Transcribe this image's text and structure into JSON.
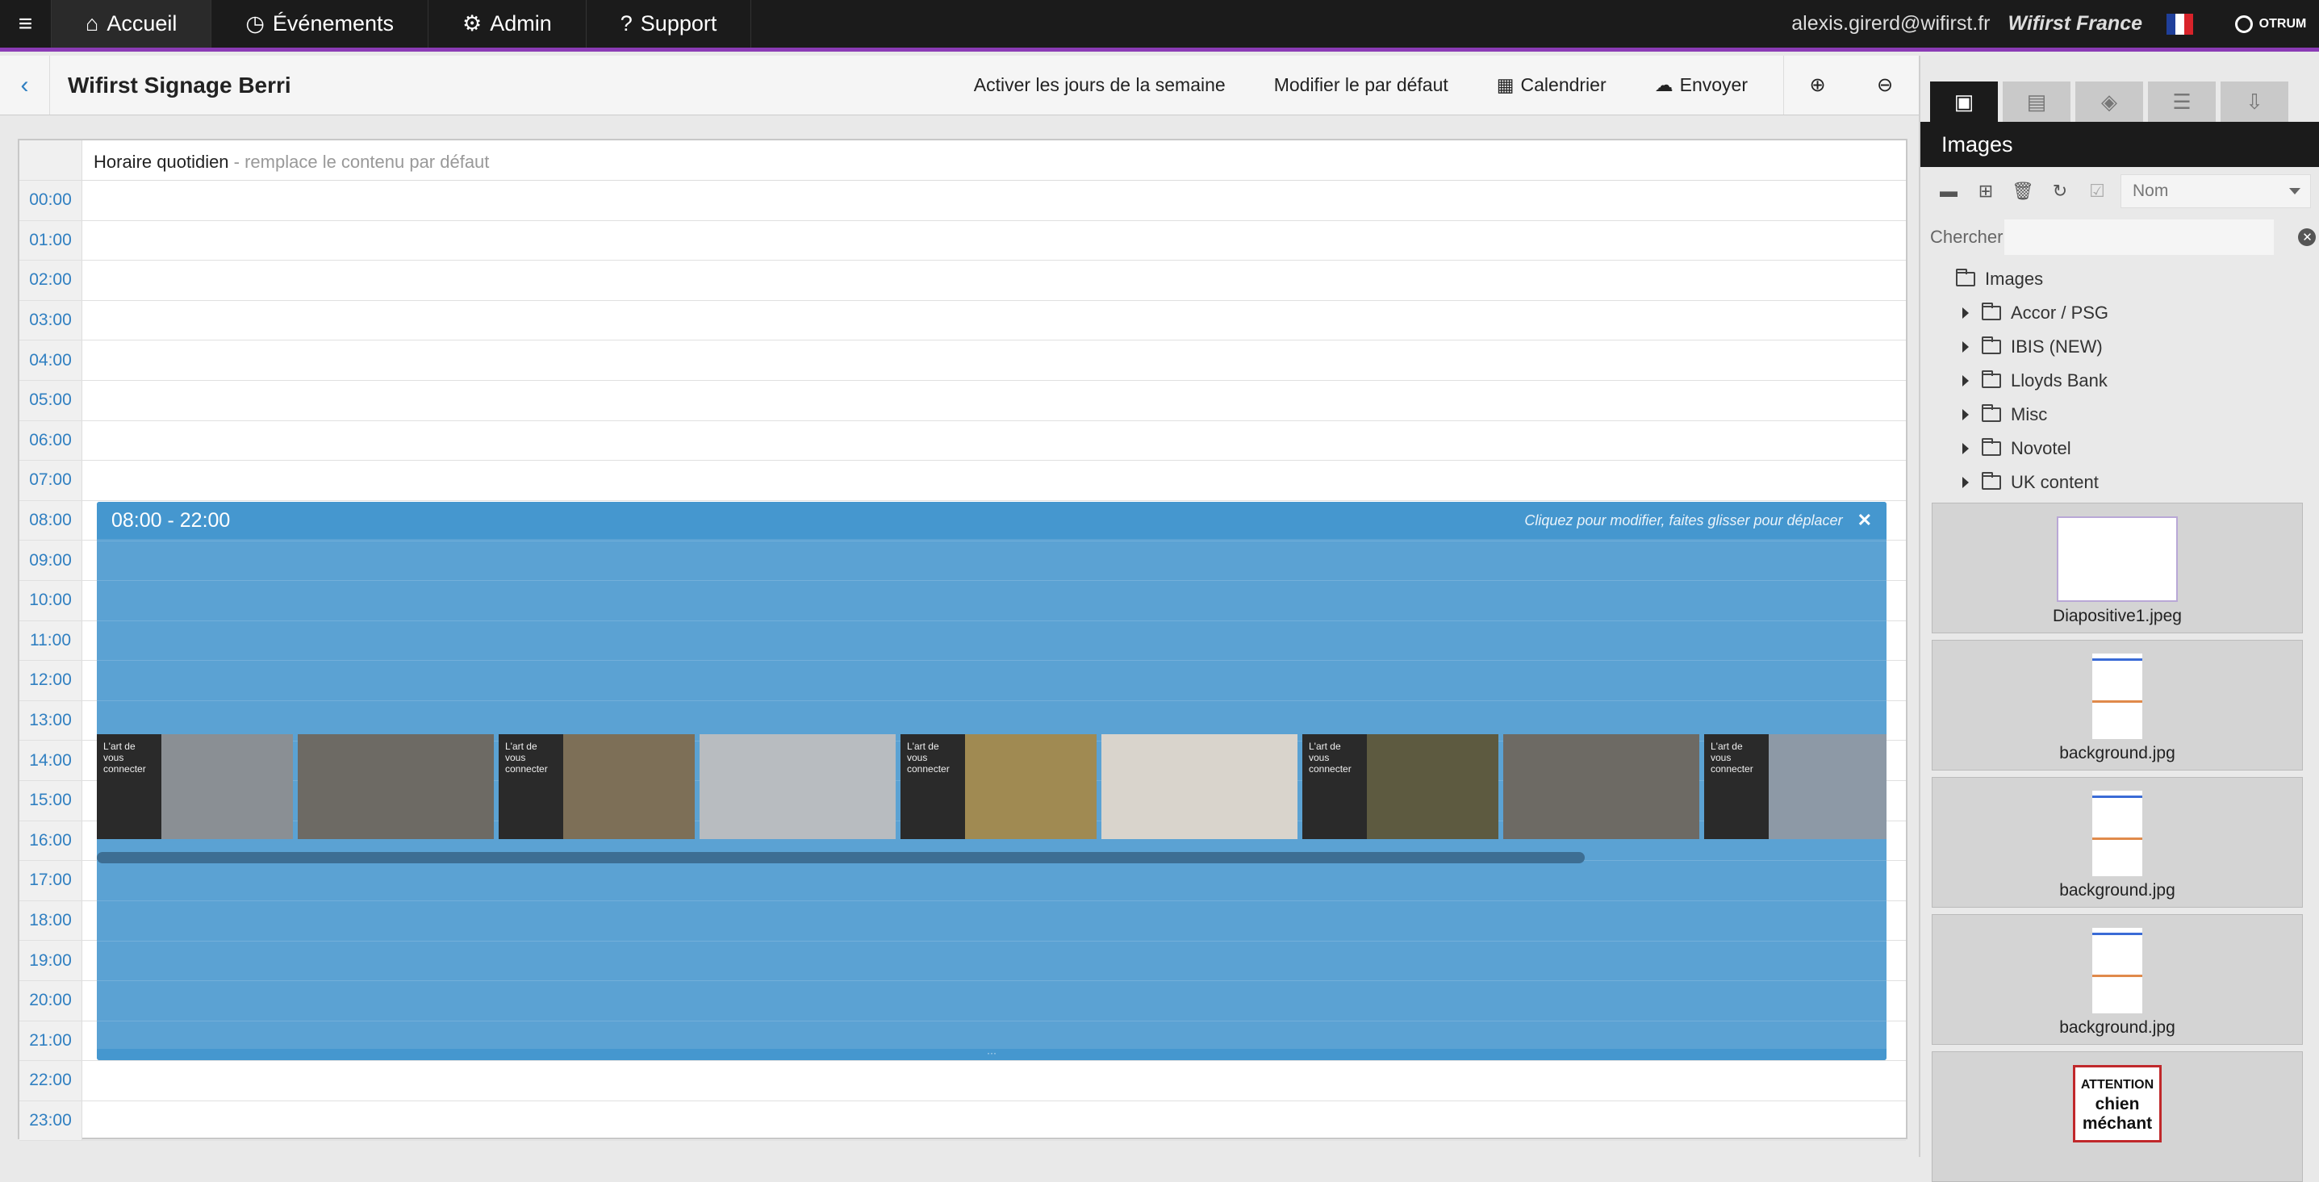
{
  "nav": {
    "items": [
      {
        "icon": "home-icon",
        "glyph": "⌂",
        "label": "Accueil"
      },
      {
        "icon": "clock-icon",
        "glyph": "◷",
        "label": "Événements"
      },
      {
        "icon": "gears-icon",
        "glyph": "⚙",
        "label": "Admin"
      },
      {
        "icon": "question-icon",
        "glyph": "?",
        "label": "Support"
      }
    ],
    "user": "alexis.girerd@wifirst.fr",
    "org": "Wifirst France",
    "brand": "OTRUM",
    "colors": {
      "accent": "#8a3bb5",
      "bar": "#1b1b1b"
    }
  },
  "toolbar": {
    "title": "Wifirst Signage Berri",
    "weekdays": "Activer les jours de la semaine",
    "default": "Modifier le par défaut",
    "calendar": "Calendrier",
    "send": "Envoyer"
  },
  "schedule": {
    "header_title": "Horaire quotidien",
    "header_sub": " - remplace le contenu par défaut",
    "hours": [
      "00:00",
      "01:00",
      "02:00",
      "03:00",
      "04:00",
      "05:00",
      "06:00",
      "07:00",
      "08:00",
      "09:00",
      "10:00",
      "11:00",
      "12:00",
      "13:00",
      "14:00",
      "15:00",
      "16:00",
      "17:00",
      "18:00",
      "19:00",
      "20:00",
      "21:00",
      "22:00",
      "23:00"
    ],
    "event": {
      "time": "08:00 - 22:00",
      "hint": "Cliquez pour modifier, faites glisser pour déplacer",
      "color": "#5ba2d3",
      "slides": [
        {
          "text": "L'art de vous connecter",
          "bg": "#8a8f94"
        },
        {
          "text": "",
          "bg": "#6d6a64"
        },
        {
          "text": "L'art de vous connecter",
          "bg": "#7d6f57"
        },
        {
          "text": "",
          "bg": "#b8bcc0"
        },
        {
          "text": "L'art de vous connecter",
          "bg": "#a08a52"
        },
        {
          "text": "",
          "bg": "#d9d4cc"
        },
        {
          "text": "L'art de vous connecter",
          "bg": "#5d5a40"
        },
        {
          "text": "",
          "bg": "#6d6a64"
        },
        {
          "text": "L'art de vous connecter",
          "bg": "#8d99a6"
        }
      ]
    }
  },
  "panel": {
    "tabs": [
      "images",
      "video",
      "package",
      "list",
      "download"
    ],
    "title": "Images",
    "sort": "Nom",
    "search_label": "Chercher",
    "search_value": "",
    "root": "Images",
    "folders": [
      "Accor / PSG",
      "IBIS (NEW)",
      "Lloyds Bank",
      "Misc",
      "Novotel",
      "UK content"
    ],
    "files": [
      "Diapositive1.jpeg",
      "background.jpg",
      "background.jpg",
      "background.jpg"
    ],
    "dog_sign": {
      "line1": "ATTENTION",
      "line2": "chien",
      "line3": "méchant"
    }
  }
}
